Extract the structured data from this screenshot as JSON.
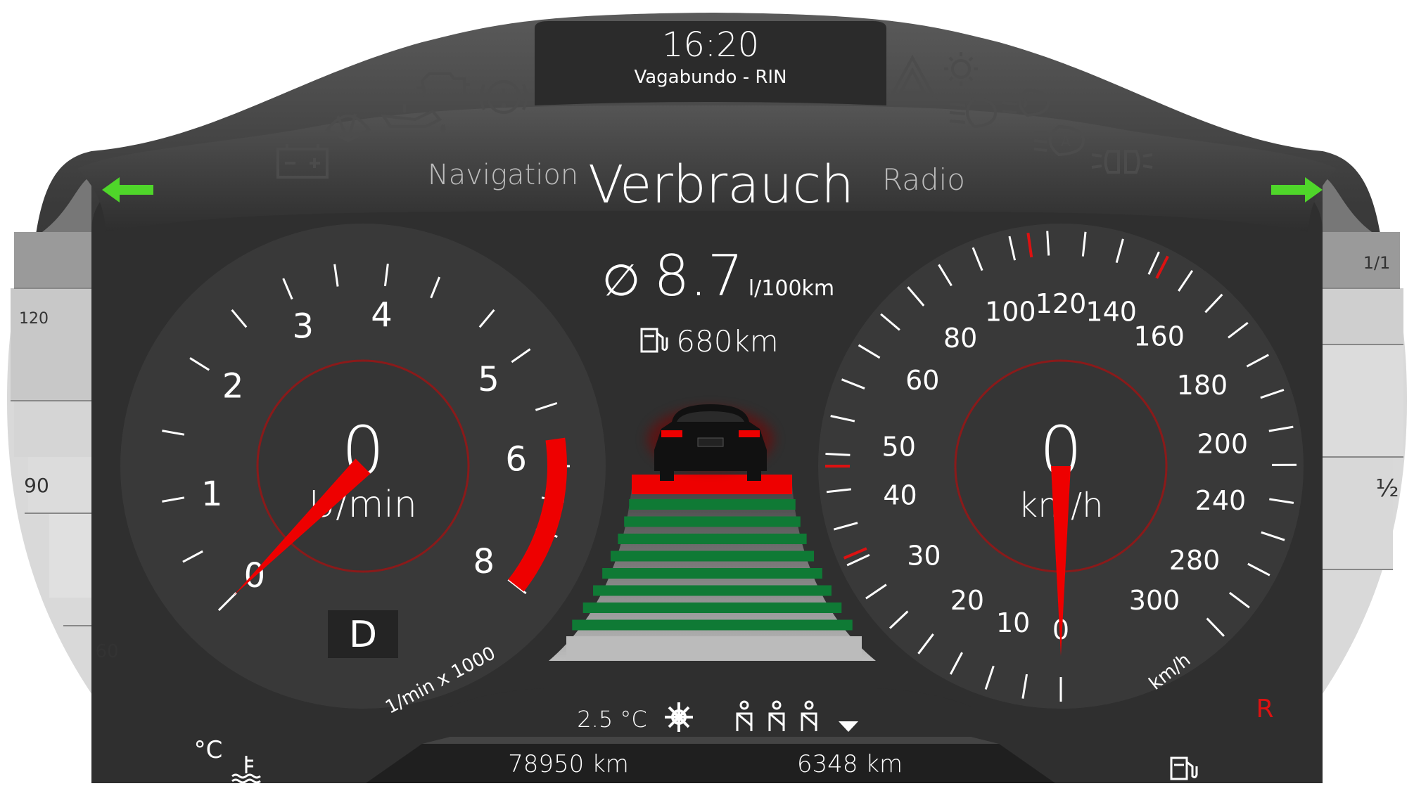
{
  "header": {
    "clock": "16:20",
    "media": "Vagabundo - RIN"
  },
  "menu": {
    "left": "Navigation",
    "center": "Verbrauch",
    "right": "Radio"
  },
  "consumption": {
    "symbol": "∅",
    "value": "8.7",
    "unit": "l/100km",
    "range": "680km"
  },
  "tachometer": {
    "value": "0",
    "unit": "U/min",
    "scale_label": "1/min x 1000",
    "ticks": [
      "0",
      "1",
      "2",
      "3",
      "4",
      "5",
      "6",
      "8"
    ],
    "gear": "D",
    "needle_fraction": 0.0
  },
  "speedometer": {
    "value": "0",
    "unit": "km/h",
    "scale_unit": "km/h",
    "ticks": [
      "0",
      "10",
      "20",
      "30",
      "40",
      "50",
      "60",
      "80",
      "100",
      "120",
      "140",
      "160",
      "180",
      "200",
      "240",
      "280",
      "300"
    ],
    "needle_fraction": 0.0
  },
  "temperature_gauge": {
    "ticks": [
      "120",
      "90",
      "60"
    ],
    "unit": "°C"
  },
  "fuel_gauge": {
    "ticks": [
      "1/1",
      "½"
    ],
    "reserve_label": "R"
  },
  "bottom_bar": {
    "outside_temp": "2.5 °C",
    "odometer": "78950 km",
    "trip": "6348 km"
  },
  "indicators": {
    "left_arrow_color": "#4fd62a",
    "right_arrow_color": "#4fd62a"
  },
  "colors": {
    "redline": "#ee0000",
    "lane_green": "#0f7a35",
    "background": "#2d2d2d"
  }
}
